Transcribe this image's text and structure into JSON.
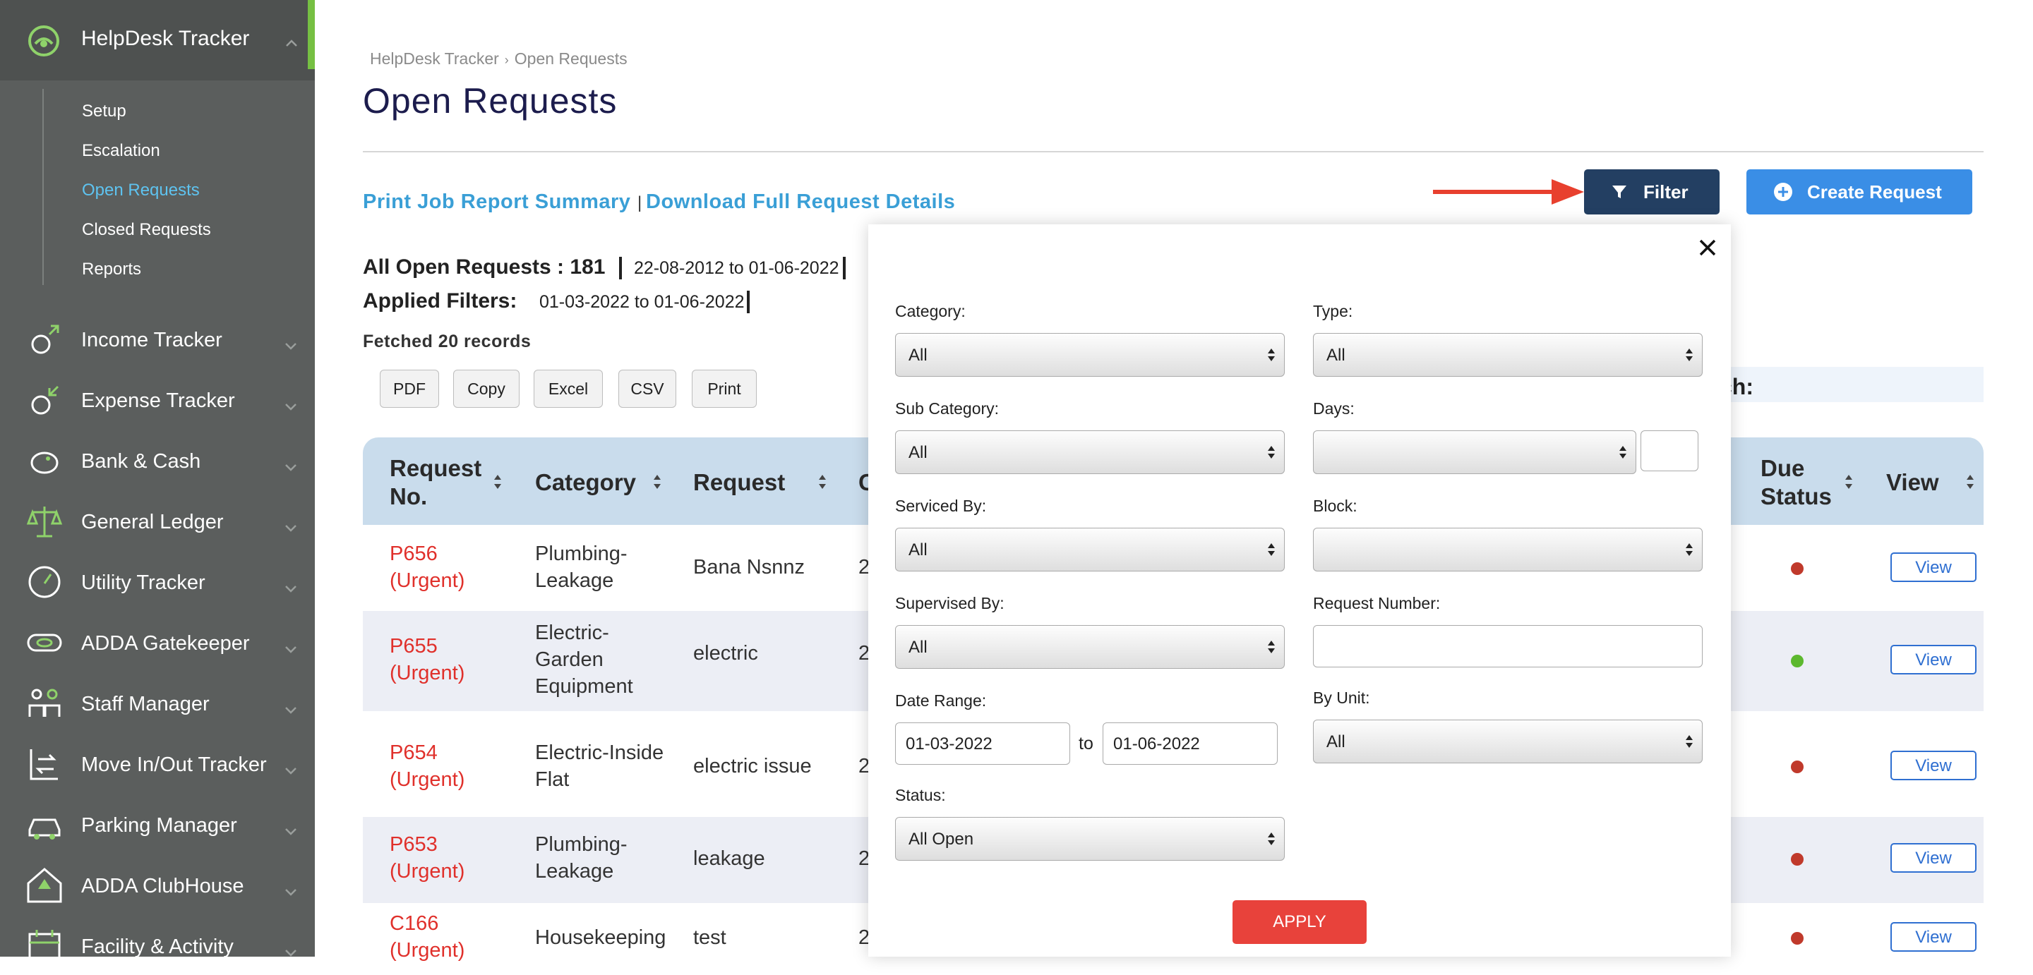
{
  "sidebar": {
    "header_title": "HelpDesk Tracker",
    "sub_items": [
      {
        "label": "Setup",
        "active": false
      },
      {
        "label": "Escalation",
        "active": false
      },
      {
        "label": "Open Requests",
        "active": true
      },
      {
        "label": "Closed Requests",
        "active": false
      },
      {
        "label": "Reports",
        "active": false
      }
    ],
    "menu": [
      {
        "label": "Income Tracker",
        "icon": "income-tracker-icon"
      },
      {
        "label": "Expense Tracker",
        "icon": "expense-tracker-icon"
      },
      {
        "label": "Bank & Cash",
        "icon": "piggy-bank-icon"
      },
      {
        "label": "General Ledger",
        "icon": "scale-icon"
      },
      {
        "label": "Utility Tracker",
        "icon": "gauge-icon"
      },
      {
        "label": "ADDA Gatekeeper",
        "icon": "gatekeeper-icon"
      },
      {
        "label": "Staff Manager",
        "icon": "staff-icon"
      },
      {
        "label": "Move In/Out Tracker",
        "icon": "move-in-out-icon"
      },
      {
        "label": "Parking Manager",
        "icon": "car-icon"
      },
      {
        "label": "ADDA ClubHouse",
        "icon": "clubhouse-icon"
      },
      {
        "label": "Facility & Activity",
        "icon": "calendar-icon"
      }
    ]
  },
  "breadcrumb": {
    "root": "HelpDesk Tracker",
    "current": "Open Requests"
  },
  "page_title": "Open Requests",
  "links": {
    "print": "Print Job Report Summary",
    "separator": "|",
    "download": "Download Full Request Details"
  },
  "buttons": {
    "filter": "Filter",
    "create": "Create Request"
  },
  "summary": {
    "label": "All Open Requests : 181",
    "range": "22-08-2012 to 01-06-2022",
    "applied_label": "Applied Filters:",
    "applied_range": "01-03-2022 to 01-06-2022",
    "fetched": "Fetched 20 records"
  },
  "export_buttons": [
    "PDF",
    "Copy",
    "Excel",
    "CSV",
    "Print"
  ],
  "search_label": "ch:",
  "table": {
    "headers": {
      "request_no": "Request No.",
      "category": "Category",
      "request": "Request",
      "partial": "C",
      "due_status": "Due Status",
      "view": "View"
    },
    "rows": [
      {
        "no": "P656 (Urgent)",
        "category": "Plumbing-Leakage",
        "request": "Bana Nsnnz",
        "date_partial": "2",
        "due": "red",
        "view": "View"
      },
      {
        "no": "P655 (Urgent)",
        "category": "Electric-Garden Equipment",
        "request": "electric",
        "date_partial": "2",
        "due": "green",
        "view": "View"
      },
      {
        "no": "P654 (Urgent)",
        "category": "Electric-Inside Flat",
        "request": "electric issue",
        "date_partial": "2",
        "due": "red",
        "view": "View"
      },
      {
        "no": "P653 (Urgent)",
        "category": "Plumbing-Leakage",
        "request": "leakage",
        "date_partial": "2",
        "due": "red",
        "view": "View"
      },
      {
        "no": "C166 (Urgent)",
        "category": "Housekeeping",
        "request": "test",
        "date_partial": "2",
        "due": "red",
        "view": "View"
      }
    ]
  },
  "filter_modal": {
    "category": {
      "label": "Category:",
      "value": "All"
    },
    "type": {
      "label": "Type:",
      "value": "All"
    },
    "sub_category": {
      "label": "Sub Category:",
      "value": "All"
    },
    "days": {
      "label": "Days:",
      "value": "",
      "input": ""
    },
    "serviced_by": {
      "label": "Serviced By:",
      "value": "All"
    },
    "block": {
      "label": "Block:",
      "value": ""
    },
    "supervised_by": {
      "label": "Supervised By:",
      "value": "All"
    },
    "request_number": {
      "label": "Request Number:",
      "value": ""
    },
    "date_range": {
      "label": "Date Range:",
      "from": "01-03-2022",
      "to_label": "to",
      "to": "01-06-2022"
    },
    "by_unit": {
      "label": "By Unit:",
      "value": "All"
    },
    "status": {
      "label": "Status:",
      "value": "All Open"
    },
    "apply": "APPLY"
  },
  "colors": {
    "sidebar_bg": "#5b5e5d",
    "active_link": "#5ec3f0",
    "accent_green": "#76c043",
    "filter_button": "#233f62",
    "create_button": "#3a8ee6",
    "apply_button": "#e8423b",
    "urgent_text": "#e0302b",
    "due_red": "#c0392b",
    "due_green": "#5cb82e",
    "arrow": "#e8402e"
  }
}
